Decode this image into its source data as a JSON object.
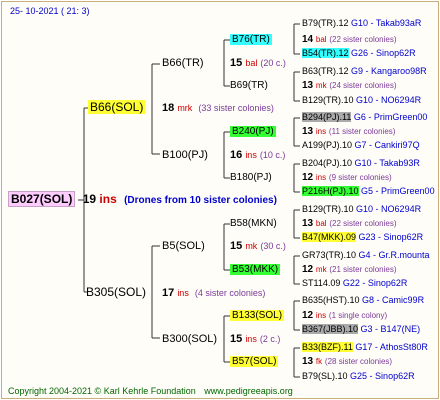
{
  "header": {
    "date": "25-  10-2021  (  21:   3)"
  },
  "root": {
    "id": "B027(SOL)",
    "num": "19",
    "word": "ins",
    "note": "(Drones from 10 sister colonies)"
  },
  "g1": [
    {
      "id": "B66(SOL)",
      "num": "18",
      "word": "mrk",
      "note": "(33 sister colonies)"
    },
    {
      "id": "B305(SOL)",
      "num": "17",
      "word": "ins",
      "note": "(4 sister colonies)"
    }
  ],
  "g2": [
    {
      "id": "B66(TR)",
      "num": "15",
      "word": "bal",
      "note": "(20 c.)"
    },
    {
      "id": "B100(PJ)",
      "num": "16",
      "word": "ins",
      "note": "(10 c.)"
    },
    {
      "id": "B5(SOL)",
      "num": "15",
      "word": "mk",
      "note": "(30 c.)"
    },
    {
      "id": "B300(SOL)",
      "num": "15",
      "word": "ins",
      "note": "(2 c.)"
    }
  ],
  "g3": [
    {
      "id": "B76(TR)",
      "num": "14",
      "word": "bal",
      "note": "(22 sister colonies)"
    },
    {
      "id": "B69(TR)",
      "num": "13",
      "word": "mk",
      "note": "(24 sister colonies)"
    },
    {
      "id": "B240(PJ)",
      "num": "13",
      "word": "ins",
      "note": "(11 sister colonies)"
    },
    {
      "id": "B180(PJ)",
      "num": "12",
      "word": "ins",
      "note": "(9 sister colonies)"
    },
    {
      "id": "B58(MKN)",
      "num": "13",
      "word": "bal",
      "note": "(22 sister colonies)"
    },
    {
      "id": "B53(MKK)",
      "num": "12",
      "word": "mk",
      "note": "(21 sister colonies)"
    },
    {
      "id": "B133(SOL)",
      "num": "12",
      "word": "ins",
      "note": "(1 single colony)"
    },
    {
      "id": "B57(SOL)",
      "num": "13",
      "word": "fk",
      "note": "(28 sister colonies)"
    }
  ],
  "g4": [
    {
      "id": "B79(TR).12",
      "code": "G10 - Takab93aR"
    },
    {
      "id": "B54(TR).12",
      "code": "G26 - Sinop62R"
    },
    {
      "id": "B63(TR).12",
      "code": "G9 - Kangaroo98R"
    },
    {
      "id": "B129(TR).10",
      "code": "G10 - NO6294R"
    },
    {
      "id": "B294(PJ).11",
      "code": "G6 - PrimGreen00"
    },
    {
      "id": "A199(PJ).10",
      "code": "G7 - Cankiri97Q"
    },
    {
      "id": "B204(PJ).10",
      "code": "G10 - Takab93R"
    },
    {
      "id": "P216H(PJ).10",
      "code": "G5 - PrimGreen00"
    },
    {
      "id": "B129(TR).10",
      "code": "G10 - NO6294R"
    },
    {
      "id": "B47(MKK).09",
      "code": "G23 - Sinop62R"
    },
    {
      "id": "GR73(TR).10",
      "code": "G4 - Gr.R.mounta"
    },
    {
      "id": "ST114.09",
      "code": "G22 - Sinop62R"
    },
    {
      "id": "B635(HST).10",
      "code": "G8 - Camic99R"
    },
    {
      "id": "B367(JBB).10",
      "code": "G3 - B147(NE)"
    },
    {
      "id": "B33(BZF).11",
      "code": "G17 - AthosSt80R"
    },
    {
      "id": "B79(SL).10",
      "code": "G25 - Sinop62R"
    }
  ],
  "footer": {
    "copyright": "Copyright 2004-2021 © Karl Kehrle Foundation",
    "url": "www.pedigreeapis.org"
  }
}
